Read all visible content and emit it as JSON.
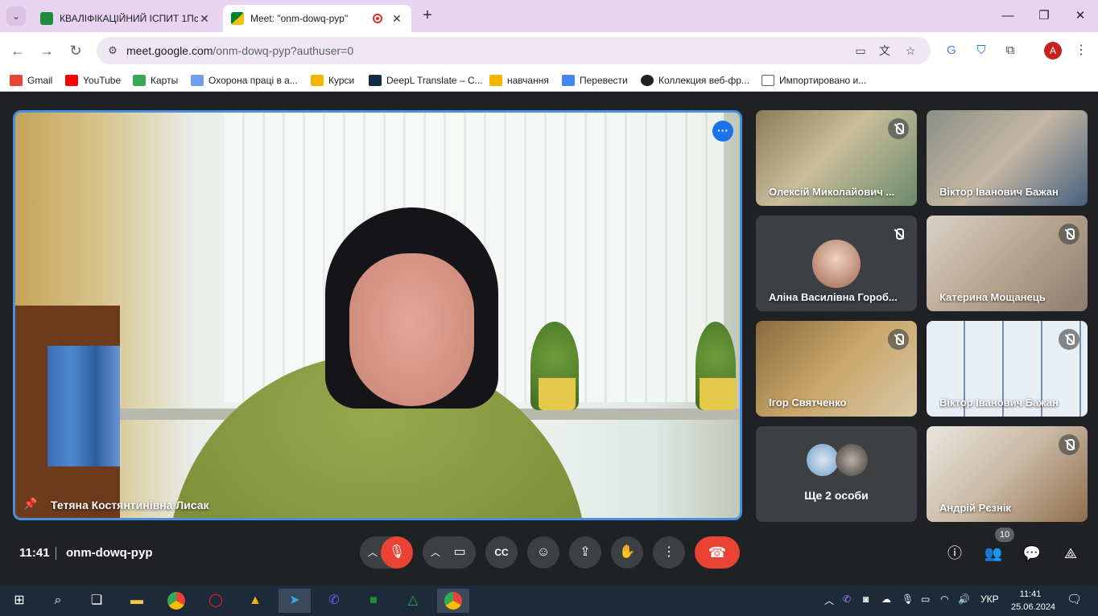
{
  "browser": {
    "tabs": [
      {
        "title": "КВАЛІФІКАЦІЙНИЙ ІСПИТ 1Пс",
        "active": false
      },
      {
        "title": "Meet: \"onm-dowq-pyp\"",
        "active": true
      }
    ],
    "close_glyph": "✕",
    "new_tab_glyph": "+",
    "window_controls": [
      "—",
      "❐",
      "✕"
    ],
    "url_host": "meet.google.com",
    "url_path": "/onm-dowq-pyp?authuser=0",
    "profile_initial": "A",
    "bookmarks": [
      {
        "label": "Gmail",
        "color": "#ea4335"
      },
      {
        "label": "YouTube",
        "color": "#ff0000"
      },
      {
        "label": "Карты",
        "color": "#34a853"
      },
      {
        "label": "Охорона праці в а...",
        "color": "#6d9eeb"
      },
      {
        "label": "Курси",
        "color": "#f4b400"
      },
      {
        "label": "DeepL Translate – С...",
        "color": "#0f2b46"
      },
      {
        "label": "навчання",
        "color": "#f4b400"
      },
      {
        "label": "Перевести",
        "color": "#4285f4"
      },
      {
        "label": "Коллекция веб-фр...",
        "color": "#202124"
      },
      {
        "label": "Импортировано и...",
        "color": "#ffffff"
      }
    ]
  },
  "meet": {
    "main_speaker": "Тетяна Костянтинівна Лисак",
    "participants": [
      {
        "name": "Олексій Миколайович ..."
      },
      {
        "name": "Віктор Іванович Бажан"
      },
      {
        "name": "Аліна Василівна Гороб..."
      },
      {
        "name": "Катерина Мощанець"
      },
      {
        "name": "Ігор Святченко"
      },
      {
        "name": "Віктор Іванович Бажан"
      },
      {
        "name": "Ще 2 особи"
      },
      {
        "name": "Андрій Рєзнік"
      }
    ],
    "time": "11:41",
    "meeting_code": "onm-dowq-pyp",
    "people_count": "10"
  },
  "taskbar": {
    "language": "УКР",
    "clock_time": "11:41",
    "clock_date": "25.06.2024"
  },
  "colors": {
    "accent_blue": "#1a73e8",
    "danger_red": "#ea4335",
    "tab_strip": "#e8d3f0",
    "meet_bg": "#202124"
  }
}
